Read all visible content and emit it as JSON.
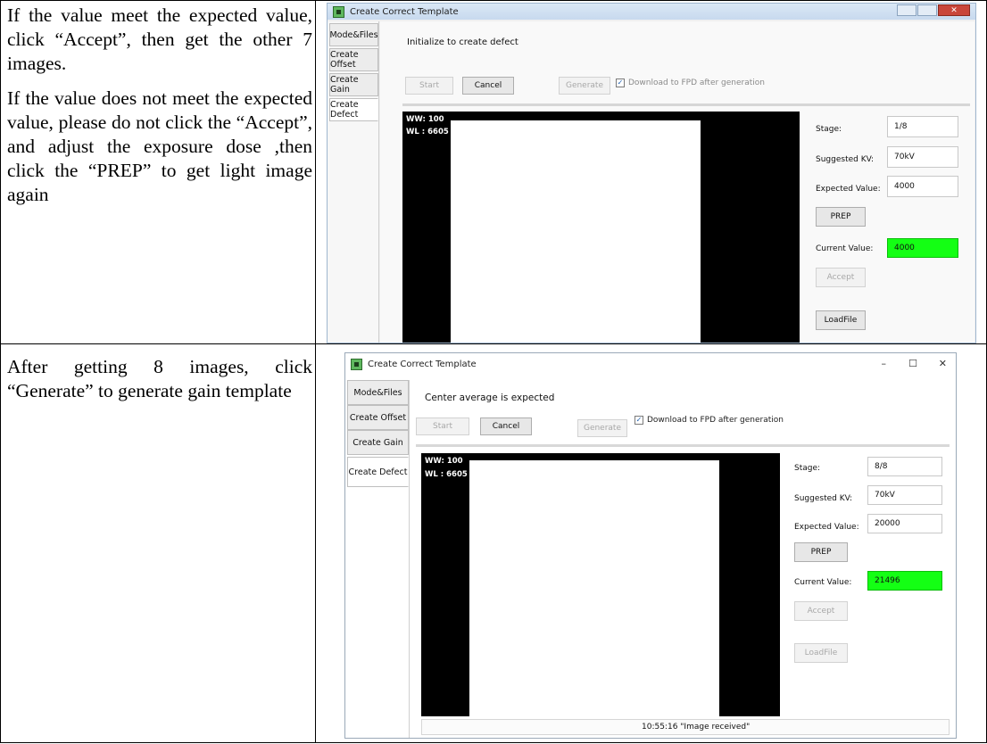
{
  "row1": {
    "paragraphs": [
      "If the value meet the expected value, click “Accept”, then get the other 7 images.",
      "If the value does not meet the expected value, please do not click the “Accept”, and adjust the exposure dose ,then click the “PREP” to get light image again"
    ],
    "window": {
      "title": "Create Correct Template",
      "tabs": [
        "Mode&Files",
        "Create Offset",
        "Create Gain",
        "Create Defect"
      ],
      "status": "Initialize to create defect",
      "start_label": "Start",
      "cancel_label": "Cancel",
      "generate_label": "Generate",
      "download_label": "Download to FPD after generation",
      "ww": "WW: 100",
      "wl": "WL : 6605",
      "stage_label": "Stage:",
      "stage_value": "1/8",
      "kv_label": "Suggested KV:",
      "kv_value": "70kV",
      "expected_label": "Expected Value:",
      "expected_value": "4000",
      "prep_label": "PREP",
      "current_label": "Current Value:",
      "current_value": "4000",
      "accept_label": "Accept",
      "loadfile_label": "LoadFile"
    }
  },
  "row2": {
    "paragraphs": [
      "After getting 8 images, click “Generate” to generate gain template"
    ],
    "window": {
      "title": "Create Correct Template",
      "minimize": "–",
      "maximize": "☐",
      "close": "✕",
      "tabs": [
        "Mode&Files",
        "Create Offset",
        "Create Gain",
        "Create Defect"
      ],
      "status": "Center average is expected",
      "start_label": "Start",
      "cancel_label": "Cancel",
      "generate_label": "Generate",
      "download_label": "Download to FPD after generation",
      "ww": "WW: 100",
      "wl": "WL : 6605",
      "stage_label": "Stage:",
      "stage_value": "8/8",
      "kv_label": "Suggested KV:",
      "kv_value": "70kV",
      "expected_label": "Expected Value:",
      "expected_value": "20000",
      "prep_label": "PREP",
      "current_label": "Current Value:",
      "current_value": "21496",
      "accept_label": "Accept",
      "loadfile_label": "LoadFile",
      "log_text": "10:55:16 \"Image received\""
    }
  }
}
